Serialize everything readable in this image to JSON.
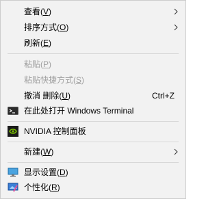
{
  "menu": {
    "items": [
      {
        "id": "view",
        "label": "查看(V)",
        "prefix": "查看(",
        "key": "V",
        "suffix": ")",
        "submenu": true,
        "disabled": false
      },
      {
        "id": "sort",
        "label": "排序方式(O)",
        "prefix": "排序方式(",
        "key": "O",
        "suffix": ")",
        "submenu": true,
        "disabled": false
      },
      {
        "id": "refresh",
        "label": "刷新(E)",
        "prefix": "刷新(",
        "key": "E",
        "suffix": ")",
        "submenu": false,
        "disabled": false
      },
      {
        "id": "paste",
        "label": "粘贴(P)",
        "prefix": "粘贴(",
        "key": "P",
        "suffix": ")",
        "submenu": false,
        "disabled": true
      },
      {
        "id": "paste-shortcut",
        "label": "粘贴快捷方式(S)",
        "prefix": "粘贴快捷方式(",
        "key": "S",
        "suffix": ")",
        "submenu": false,
        "disabled": true
      },
      {
        "id": "undo-delete",
        "label": "撤消 删除(U)",
        "prefix": "撤消 删除(",
        "key": "U",
        "suffix": ")",
        "shortcut": "Ctrl+Z",
        "submenu": false,
        "disabled": false
      },
      {
        "id": "open-terminal",
        "label": "在此处打开 Windows Terminal",
        "icon": "terminal-icon",
        "submenu": false,
        "disabled": false
      },
      {
        "id": "nvidia",
        "label": "NVIDIA 控制面板",
        "icon": "nvidia-icon",
        "submenu": false,
        "disabled": false
      },
      {
        "id": "new",
        "label": "新建(W)",
        "prefix": "新建(",
        "key": "W",
        "suffix": ")",
        "submenu": true,
        "disabled": false
      },
      {
        "id": "display",
        "label": "显示设置(D)",
        "prefix": "显示设置(",
        "key": "D",
        "suffix": ")",
        "icon": "display-settings-icon",
        "submenu": false,
        "disabled": false
      },
      {
        "id": "personalize",
        "label": "个性化(R)",
        "prefix": "个性化(",
        "key": "R",
        "suffix": ")",
        "icon": "personalize-icon",
        "submenu": false,
        "disabled": false
      }
    ]
  },
  "colors": {
    "background": "#f2f2f2",
    "border": "#cccccc",
    "disabled_text": "#a0a0a0",
    "separator": "#d7d7d7",
    "nvidia_green": "#76b900"
  }
}
